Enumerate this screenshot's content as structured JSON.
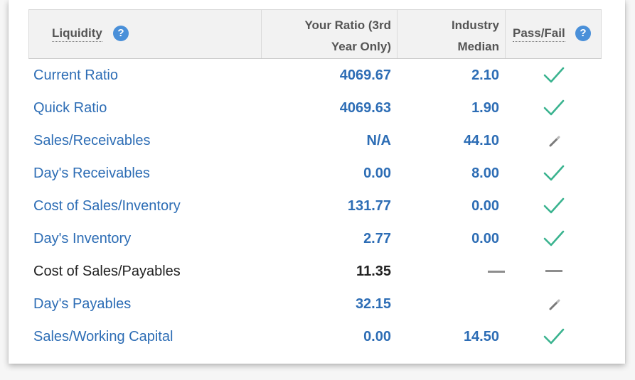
{
  "header": {
    "liquidity_label": "Liquidity",
    "help_symbol": "?",
    "your_ratio_line1": "Your Ratio (3rd",
    "your_ratio_line2": "Year Only)",
    "industry_line1": "Industry",
    "industry_line2": "Median",
    "pass_fail_label": "Pass/Fail"
  },
  "colors": {
    "link_blue": "#2d6db5",
    "check_green": "#3ab38f",
    "pencil_gray": "#7a7a7a",
    "dash_gray": "#8d8d8d"
  },
  "rows": [
    {
      "name": "Current Ratio",
      "your_ratio": "4069.67",
      "industry_median": "2.10",
      "status": "check-icon",
      "style": "link"
    },
    {
      "name": "Quick Ratio",
      "your_ratio": "4069.63",
      "industry_median": "1.90",
      "status": "check-icon",
      "style": "link"
    },
    {
      "name": "Sales/Receivables",
      "your_ratio": "N/A",
      "industry_median": "44.10",
      "status": "pencil-icon",
      "style": "link"
    },
    {
      "name": "Day's Receivables",
      "your_ratio": "0.00",
      "industry_median": "8.00",
      "status": "check-icon",
      "style": "link"
    },
    {
      "name": "Cost of Sales/Inventory",
      "your_ratio": "131.77",
      "industry_median": "0.00",
      "status": "check-icon",
      "style": "link"
    },
    {
      "name": "Day's Inventory",
      "your_ratio": "2.77",
      "industry_median": "0.00",
      "status": "check-icon",
      "style": "link"
    },
    {
      "name": "Cost of Sales/Payables",
      "your_ratio": "11.35",
      "industry_median": "",
      "industry_dash": true,
      "status": "dash-icon",
      "style": "dark"
    },
    {
      "name": "Day's Payables",
      "your_ratio": "32.15",
      "industry_median": "",
      "status": "pencil-icon",
      "style": "link"
    },
    {
      "name": "Sales/Working Capital",
      "your_ratio": "0.00",
      "industry_median": "14.50",
      "status": "check-icon",
      "style": "link"
    }
  ]
}
